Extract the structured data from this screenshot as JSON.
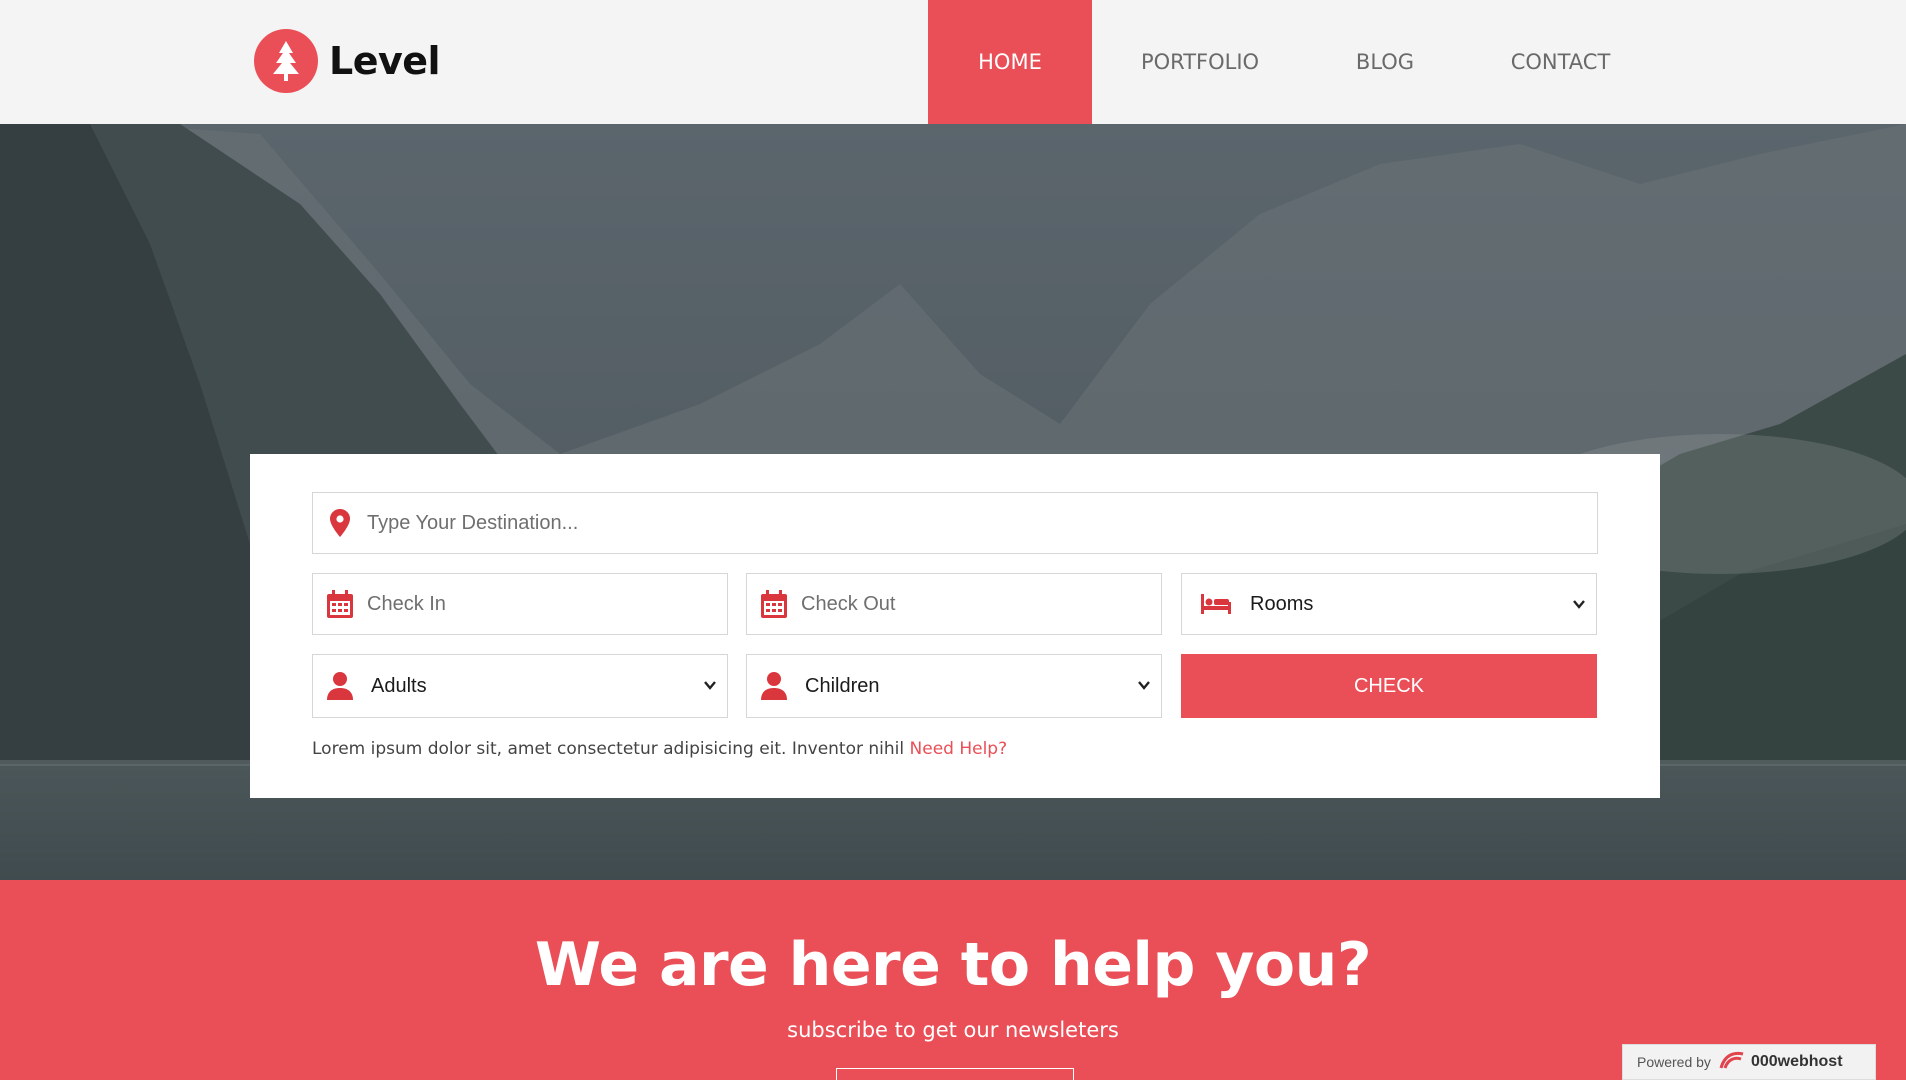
{
  "header": {
    "logo_text": "Level",
    "nav": [
      {
        "label": "HOME",
        "active": true
      },
      {
        "label": "PORTFOLIO",
        "active": false
      },
      {
        "label": "BLOG",
        "active": false
      },
      {
        "label": "CONTACT",
        "active": false
      }
    ]
  },
  "search": {
    "destination_placeholder": "Type Your Destination...",
    "checkin_placeholder": "Check In",
    "checkout_placeholder": "Check Out",
    "rooms_selected": "Rooms",
    "adults_selected": "Adults",
    "children_selected": "Children",
    "check_label": "CHECK",
    "help_text": "Lorem ipsum dolor sit, amet consectetur adipisicing eit. Inventor nihil ",
    "help_link": "Need Help?"
  },
  "newsletter": {
    "title": "We are here to help you?",
    "subtitle": "subscribe to get our newsleters"
  },
  "badge": {
    "prefix": "Powered by",
    "brand": "000webhost"
  },
  "colors": {
    "accent": "#ea4f57",
    "header_bg": "#f4f4f4"
  },
  "icons": [
    "tree-icon",
    "map-pin-icon",
    "calendar-icon",
    "bed-icon",
    "user-icon",
    "chevron-down-icon"
  ]
}
